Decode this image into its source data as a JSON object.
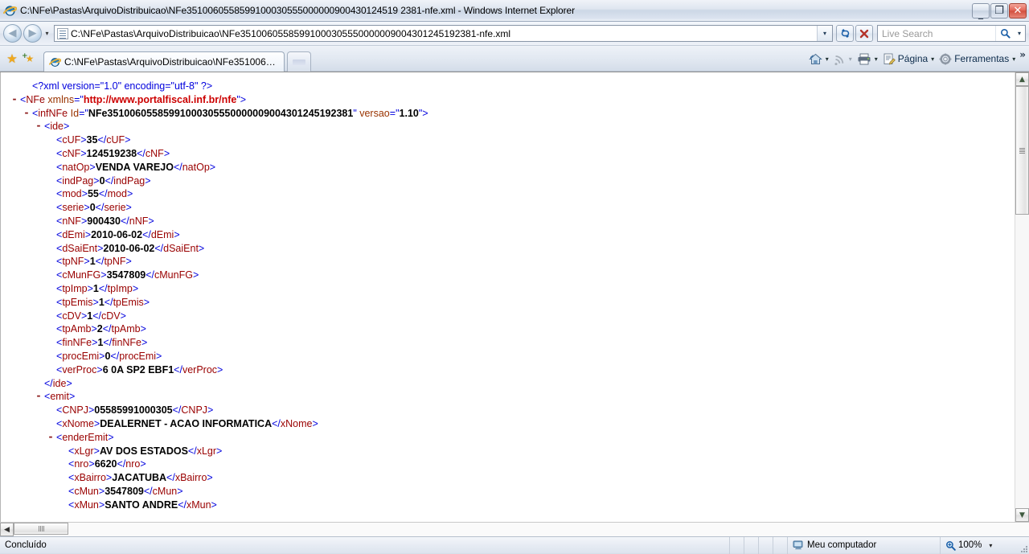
{
  "window": {
    "title": "C:\\NFe\\Pastas\\ArquivoDistribuicao\\NFe35100605585991000305550000090043012451923 81-nfe.xml - Windows Internet Explorer",
    "title_full": "C:\\NFe\\Pastas\\ArquivoDistribuicao\\NFe3510060558599100030555000000900430124519 2381-nfe.xml - Windows Internet Explorer",
    "minimize_label": "_",
    "maximize_label": "❐",
    "close_label": "✕"
  },
  "toolbar": {
    "back_label": "◀",
    "forward_label": "▶",
    "history_caret": "▾",
    "address_value": "C:\\NFe\\Pastas\\ArquivoDistribuicao\\NFe35100605585991000305550000009004301245192381-nfe.xml",
    "address_caret": "▾",
    "refresh_label": "↻",
    "stop_label": "✕",
    "search_placeholder": "Live Search",
    "search_caret": "▾"
  },
  "tabs": {
    "favorites_label": "★",
    "add_favorites_label": "★",
    "items": [
      {
        "label": "C:\\NFe\\Pastas\\ArquivoDistribuicao\\NFe35100605585…",
        "active": true
      }
    ],
    "new_tab_label": ""
  },
  "command_bar": {
    "home_caret": "▾",
    "feeds_caret": "▾",
    "print_caret": "▾",
    "page_label": "Página",
    "page_caret": "▾",
    "tools_label": "Ferramentas",
    "tools_caret": "▾",
    "overflow_label": "»"
  },
  "xml": {
    "lines": [
      {
        "indent": 1,
        "toggle": "",
        "type": "pi",
        "content": "<?xml version=\"1.0\" encoding=\"utf-8\" ?>"
      },
      {
        "indent": 0,
        "toggle": "-",
        "type": "open_attr",
        "tag": "NFe",
        "attrs": [
          {
            "name": "xmlns",
            "value": "http://www.portalfiscal.inf.br/nfe",
            "url": true
          }
        ]
      },
      {
        "indent": 1,
        "toggle": "-",
        "type": "open_attr",
        "tag": "infNFe",
        "attrs": [
          {
            "name": "Id",
            "value": "NFe35100605585991000305550000009004301245192381"
          },
          {
            "name": "versao",
            "value": "1.10"
          }
        ]
      },
      {
        "indent": 2,
        "toggle": "-",
        "type": "open",
        "tag": "ide"
      },
      {
        "indent": 3,
        "toggle": "",
        "type": "leaf",
        "tag": "cUF",
        "value": "35"
      },
      {
        "indent": 3,
        "toggle": "",
        "type": "leaf",
        "tag": "cNF",
        "value": "124519238"
      },
      {
        "indent": 3,
        "toggle": "",
        "type": "leaf",
        "tag": "natOp",
        "value": "VENDA VAREJO"
      },
      {
        "indent": 3,
        "toggle": "",
        "type": "leaf",
        "tag": "indPag",
        "value": "0"
      },
      {
        "indent": 3,
        "toggle": "",
        "type": "leaf",
        "tag": "mod",
        "value": "55"
      },
      {
        "indent": 3,
        "toggle": "",
        "type": "leaf",
        "tag": "serie",
        "value": "0"
      },
      {
        "indent": 3,
        "toggle": "",
        "type": "leaf",
        "tag": "nNF",
        "value": "900430"
      },
      {
        "indent": 3,
        "toggle": "",
        "type": "leaf",
        "tag": "dEmi",
        "value": "2010-06-02"
      },
      {
        "indent": 3,
        "toggle": "",
        "type": "leaf",
        "tag": "dSaiEnt",
        "value": "2010-06-02"
      },
      {
        "indent": 3,
        "toggle": "",
        "type": "leaf",
        "tag": "tpNF",
        "value": "1"
      },
      {
        "indent": 3,
        "toggle": "",
        "type": "leaf",
        "tag": "cMunFG",
        "value": "3547809"
      },
      {
        "indent": 3,
        "toggle": "",
        "type": "leaf",
        "tag": "tpImp",
        "value": "1"
      },
      {
        "indent": 3,
        "toggle": "",
        "type": "leaf",
        "tag": "tpEmis",
        "value": "1"
      },
      {
        "indent": 3,
        "toggle": "",
        "type": "leaf",
        "tag": "cDV",
        "value": "1"
      },
      {
        "indent": 3,
        "toggle": "",
        "type": "leaf",
        "tag": "tpAmb",
        "value": "2"
      },
      {
        "indent": 3,
        "toggle": "",
        "type": "leaf",
        "tag": "finNFe",
        "value": "1"
      },
      {
        "indent": 3,
        "toggle": "",
        "type": "leaf",
        "tag": "procEmi",
        "value": "0"
      },
      {
        "indent": 3,
        "toggle": "",
        "type": "leaf",
        "tag": "verProc",
        "value": "6 0A SP2 EBF1"
      },
      {
        "indent": 2,
        "toggle": "",
        "type": "close",
        "tag": "ide"
      },
      {
        "indent": 2,
        "toggle": "-",
        "type": "open",
        "tag": "emit"
      },
      {
        "indent": 3,
        "toggle": "",
        "type": "leaf",
        "tag": "CNPJ",
        "value": "05585991000305"
      },
      {
        "indent": 3,
        "toggle": "",
        "type": "leaf",
        "tag": "xNome",
        "value": "DEALERNET - ACAO INFORMATICA"
      },
      {
        "indent": 3,
        "toggle": "-",
        "type": "open",
        "tag": "enderEmit"
      },
      {
        "indent": 4,
        "toggle": "",
        "type": "leaf",
        "tag": "xLgr",
        "value": "AV DOS ESTADOS"
      },
      {
        "indent": 4,
        "toggle": "",
        "type": "leaf",
        "tag": "nro",
        "value": "6620"
      },
      {
        "indent": 4,
        "toggle": "",
        "type": "leaf",
        "tag": "xBairro",
        "value": "JACATUBA"
      },
      {
        "indent": 4,
        "toggle": "",
        "type": "leaf",
        "tag": "cMun",
        "value": "3547809"
      },
      {
        "indent": 4,
        "toggle": "",
        "type": "leaf",
        "tag": "xMun",
        "value": "SANTO ANDRE"
      }
    ]
  },
  "scrollbars": {
    "v_up_label": "▲",
    "v_down_label": "▼",
    "h_left_label": "◀",
    "h_right_label": "▶"
  },
  "status": {
    "message": "Concluído",
    "zone": "Meu computador",
    "zoom": "100%",
    "zoom_caret": "▾"
  },
  "colors": {
    "bracket": "#0000dd",
    "tag": "#990000",
    "attribute": "#993300",
    "value": "#000000",
    "url_value": "#cc0000",
    "toggle": "#8b1a1a"
  }
}
